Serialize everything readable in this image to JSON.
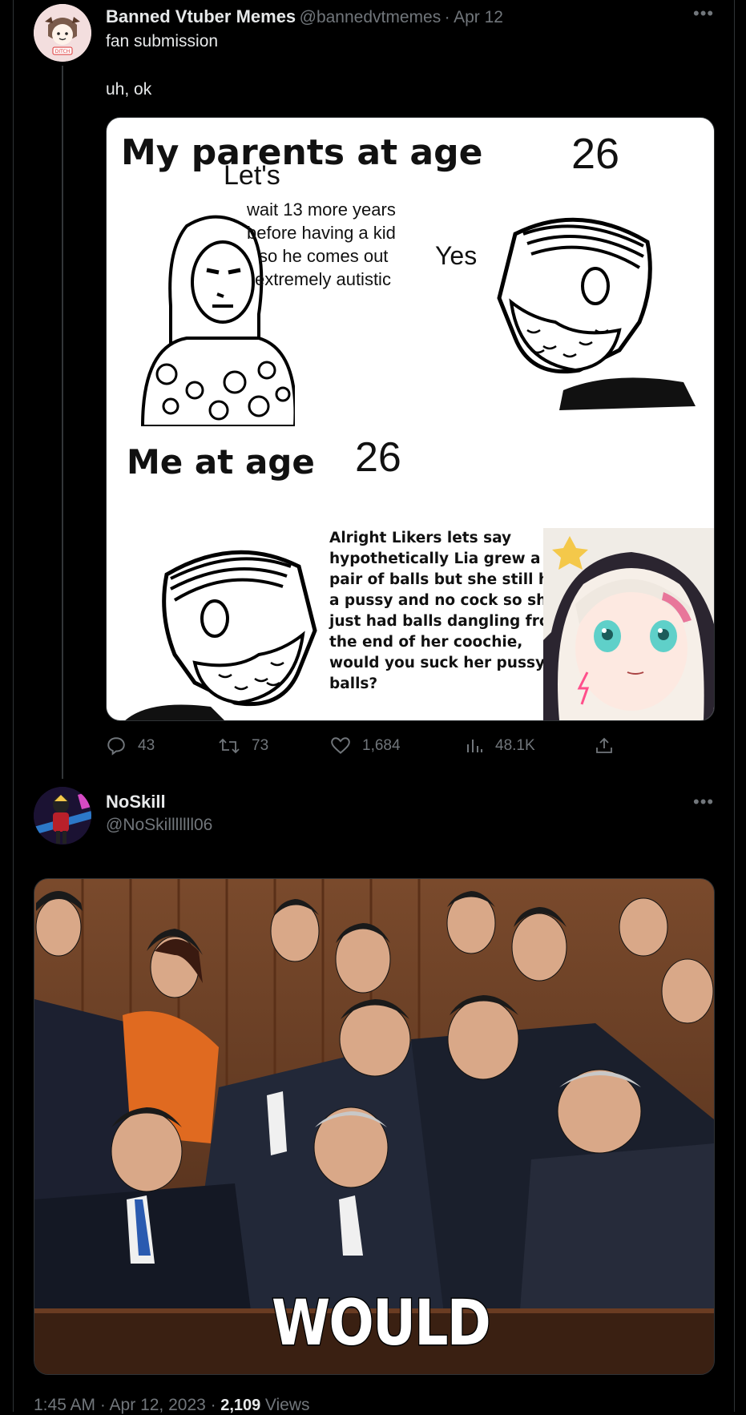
{
  "post1": {
    "author_name": "Banned Vtuber Memes",
    "author_handle": "@bannedvtmemes",
    "separator": "·",
    "date": "Apr 12",
    "more_icon": "more-horizontal-icon",
    "line1": "fan submission",
    "line2": "uh, ok",
    "avatar_badge": "DITCH",
    "meme": {
      "title_top": "My parents at age",
      "age_top": "26",
      "woman_speech_1": "Let's",
      "woman_speech_2": "wait 13 more years",
      "woman_speech_3": "before having a kid",
      "woman_speech_4": "so he comes out",
      "woman_speech_5": "extremely autistic",
      "man_reply": "Yes",
      "title_bottom": "Me at age",
      "age_bottom": "26",
      "caption_lines": [
        "Alright Likers lets say",
        "hypothetically Lia grew a",
        "pair of balls but she still had",
        "a pussy and no cock so she",
        "just had balls dangling from",
        "the end of her coochie,",
        "would you suck her pussy",
        "balls?"
      ]
    },
    "actions": {
      "reply_count": "43",
      "retweet_count": "73",
      "like_count": "1,684",
      "views_count": "48.1K",
      "reply_icon": "reply-icon",
      "retweet_icon": "retweet-icon",
      "like_icon": "heart-icon",
      "views_icon": "views-icon",
      "share_icon": "share-icon"
    }
  },
  "post2": {
    "author_name": "NoSkill",
    "author_handle": "@NoSkilllllll06",
    "more_icon": "more-horizontal-icon",
    "image_caption": "WOULD",
    "timestamp": "1:45 AM · Apr 12, 2023 ·",
    "views_number": "2,109",
    "views_label": "Views"
  },
  "colors": {
    "background": "#000000",
    "text_primary": "#e7e9ea",
    "text_muted": "#71767b",
    "border": "#2f3336"
  }
}
